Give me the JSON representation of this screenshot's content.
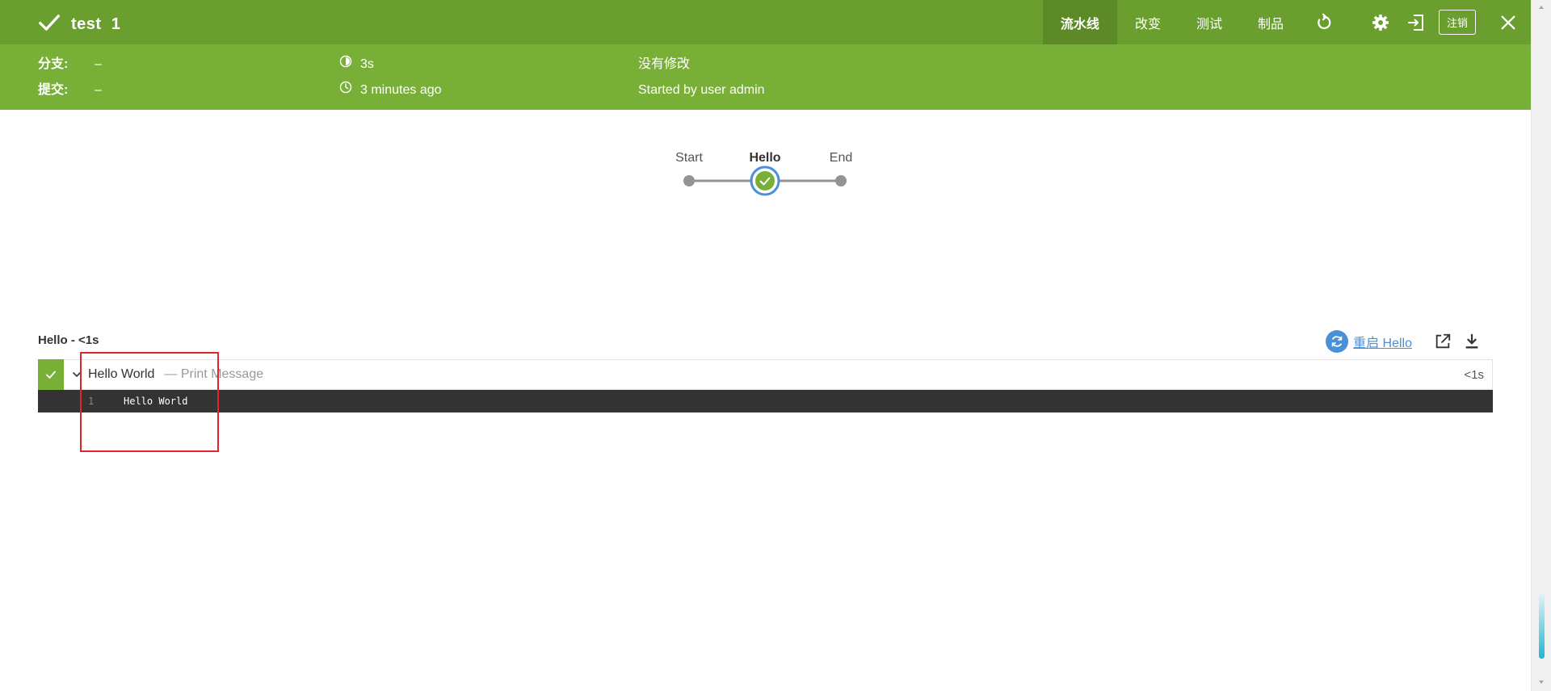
{
  "header": {
    "title": "test",
    "run_number": "1",
    "tabs": [
      {
        "label": "流水线",
        "active": true
      },
      {
        "label": "改变",
        "active": false
      },
      {
        "label": "测试",
        "active": false
      },
      {
        "label": "制品",
        "active": false
      }
    ],
    "logout_label": "注销",
    "icons": [
      "replay-icon",
      "gear-icon",
      "exit-icon",
      "close-icon"
    ]
  },
  "meta": {
    "branch_label": "分支:",
    "branch_value": "–",
    "commit_label": "提交:",
    "commit_value": "–",
    "duration": "3s",
    "time_ago": "3 minutes ago",
    "changes": "没有修改",
    "started_by": "Started by user admin"
  },
  "pipeline": {
    "stages": [
      {
        "label": "Start",
        "status": "none",
        "selected": false
      },
      {
        "label": "Hello",
        "status": "success",
        "selected": true
      },
      {
        "label": "End",
        "status": "none",
        "selected": false
      }
    ]
  },
  "step_panel": {
    "title": "Hello - <1s",
    "restart_label": "重启 Hello",
    "steps": [
      {
        "name": "Hello World",
        "description": "— Print Message",
        "duration": "<1s",
        "status": "success",
        "log": [
          {
            "line": "1",
            "text": "Hello World"
          }
        ]
      }
    ]
  },
  "colors": {
    "header": "#78b037",
    "topbar": "#6a9f2f",
    "active_tab": "#5b8a27",
    "success": "#78b037",
    "link": "#4a90d9",
    "annotation": "#e0262c",
    "log_bg": "#333333"
  }
}
